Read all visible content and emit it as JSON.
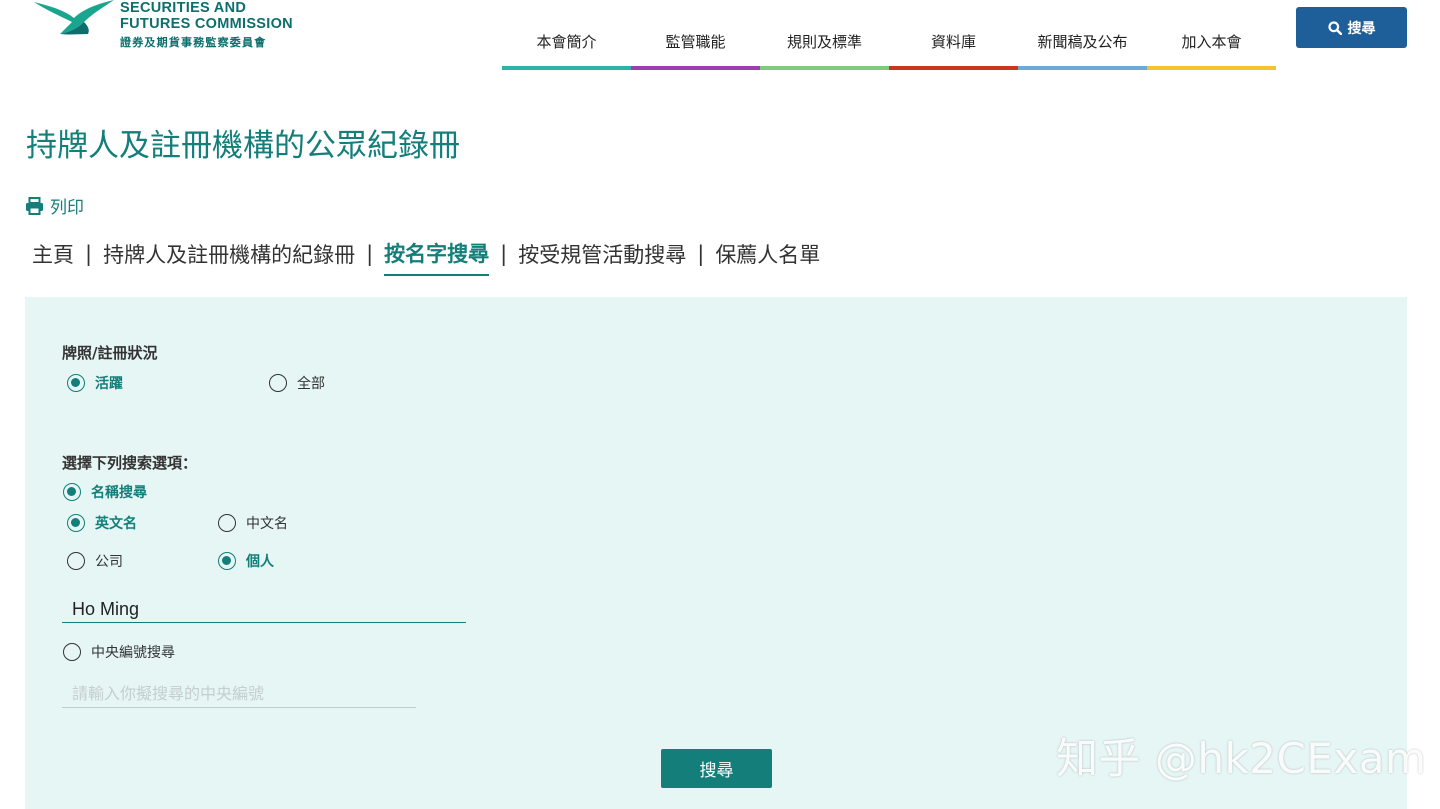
{
  "logo": {
    "en_line1": "SECURITIES AND",
    "en_line2": "FUTURES COMMISSION",
    "zh": "證券及期貨事務監察委員會",
    "brand_color": "#0d6e6e"
  },
  "nav": {
    "items": [
      {
        "label": "本會簡介",
        "color": "#2bb5a8"
      },
      {
        "label": "監管職能",
        "color": "#9c3fb0"
      },
      {
        "label": "規則及標準",
        "color": "#7ecb7e"
      },
      {
        "label": "資料庫",
        "color": "#c8361f"
      },
      {
        "label": "新聞稿及公布",
        "color": "#6baad8"
      },
      {
        "label": "加入本會",
        "color": "#f4c430"
      }
    ],
    "search_label": "搜尋",
    "search_icon": "search-icon",
    "search_color": "#1f5f99"
  },
  "page": {
    "title": "持牌人及註冊機構的公眾紀錄冊",
    "print_label": "列印",
    "print_icon": "printer-icon",
    "accent": "#137e7a"
  },
  "breadcrumb": {
    "items": [
      {
        "label": "主頁"
      },
      {
        "label": "持牌人及註冊機構的紀錄冊"
      },
      {
        "label": "按名字搜尋",
        "active": true
      },
      {
        "label": "按受規管活動搜尋"
      },
      {
        "label": "保薦人名單"
      }
    ]
  },
  "form": {
    "panel_color": "#e6f6f4",
    "status": {
      "label": "牌照/註冊狀況",
      "options": [
        {
          "label": "活躍",
          "checked": true
        },
        {
          "label": "全部",
          "checked": false
        }
      ]
    },
    "search_options_label": "選擇下列搜索選項：",
    "name_search": {
      "label": "名稱搜尋",
      "checked": true,
      "lang_options": [
        {
          "label": "英文名",
          "checked": true
        },
        {
          "label": "中文名",
          "checked": false
        }
      ],
      "type_options": [
        {
          "label": "公司",
          "checked": false
        },
        {
          "label": "個人",
          "checked": true
        }
      ],
      "value": "Ho Ming"
    },
    "cid_search": {
      "label": "中央編號搜尋",
      "checked": false,
      "placeholder": "請輸入你擬搜尋的中央編號",
      "value": ""
    },
    "submit_label": "搜尋"
  },
  "watermark": "知乎 @hk2CExam"
}
